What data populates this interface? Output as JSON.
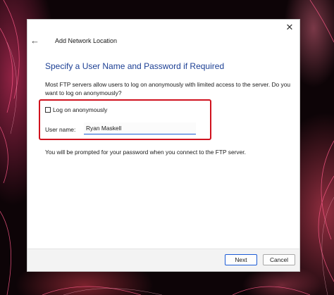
{
  "dialog": {
    "wizard_title": "Add Network Location",
    "heading": "Specify a User Name and Password if Required",
    "description": "Most FTP servers allow users to log on anonymously with limited access to the server.  Do you want to log on anonymously?",
    "anonymous_label": "Log on anonymously",
    "anonymous_checked": false,
    "user_name_label": "User name:",
    "user_name_value": "Ryan Maskell",
    "prompt_note": "You will be prompted for your password when you connect to the FTP server.",
    "next_label": "Next",
    "cancel_label": "Cancel"
  },
  "icons": {
    "close": "close-icon",
    "back": "back-arrow-icon"
  },
  "colors": {
    "heading": "#1c3f94",
    "highlight_border": "#d0121e",
    "focus_accent": "#1c5bd6"
  }
}
